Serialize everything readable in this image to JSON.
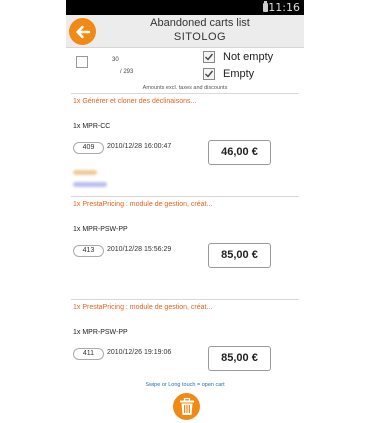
{
  "status_bar": {
    "clock": "11:16"
  },
  "header": {
    "title": "Abandoned carts list",
    "subtitle": "SITOLOG"
  },
  "filters": {
    "count_top": "30",
    "count_bottom": "/ 293",
    "not_empty_label": "Not empty",
    "empty_label": "Empty",
    "note": "Amounts excl. taxes and discounts"
  },
  "carts": [
    {
      "product": "1x Générer et cloner des déclinaisons...",
      "reference": "1x MPR-CC",
      "id": "409",
      "date": "2010/12/28 16:00:47",
      "amount": "46,00 €"
    },
    {
      "product": "1x PrestaPricing : module de gestion, créat...",
      "reference": "1x MPR-PSW-PP",
      "id": "413",
      "date": "2010/12/28 15:56:29",
      "amount": "85,00 €"
    },
    {
      "product": "1x PrestaPricing : module de gestion, créat...",
      "reference": "1x MPR-PSW-PP",
      "id": "411",
      "date": "2010/12/26 19:19:06",
      "amount": "85,00 €"
    }
  ],
  "footer": {
    "hint": "Swipe or Long touch = open cart"
  },
  "colors": {
    "accent": "#f08a14",
    "product_text": "#e8621a",
    "hint_text": "#2a6fb0"
  },
  "icons": {
    "back": "arrow-left-icon",
    "trash": "trash-icon",
    "checkmark": "checkmark-icon",
    "battery": "battery-icon"
  }
}
